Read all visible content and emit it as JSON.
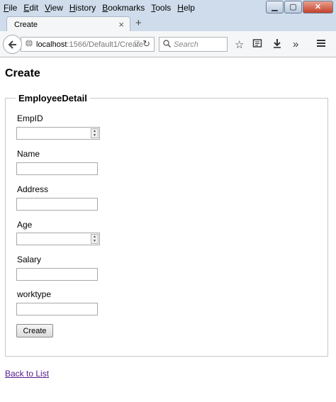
{
  "menu": {
    "items": [
      {
        "key": "F",
        "rest": "ile"
      },
      {
        "key": "E",
        "rest": "dit"
      },
      {
        "key": "V",
        "rest": "iew"
      },
      {
        "key": "H",
        "rest": "istory"
      },
      {
        "key": "B",
        "rest": "ookmarks"
      },
      {
        "key": "T",
        "rest": "ools"
      },
      {
        "key": "H",
        "rest": "elp"
      }
    ]
  },
  "window_controls": {
    "minimize": "▁",
    "maximize": "▢",
    "close": "✕"
  },
  "tab": {
    "title": "Create",
    "close": "×",
    "new_tab": "+"
  },
  "navbar": {
    "url_host": "localhost",
    "url_path": ":1566/Default1/Create",
    "search_placeholder": "Search",
    "icons": [
      "back-arrow-icon",
      "globe-icon",
      "reload-icon",
      "search-icon",
      "bookmark-star-icon",
      "reading-list-icon",
      "download-icon",
      "overflow-chevron-icon",
      "hamburger-menu-icon"
    ]
  },
  "page": {
    "title": "Create",
    "legend": "EmployeeDetail",
    "fields": [
      {
        "label": "EmpID",
        "value": "",
        "type": "number"
      },
      {
        "label": "Name",
        "value": "",
        "type": "text"
      },
      {
        "label": "Address",
        "value": "",
        "type": "text"
      },
      {
        "label": "Age",
        "value": "",
        "type": "number"
      },
      {
        "label": "Salary",
        "value": "",
        "type": "text"
      },
      {
        "label": "worktype",
        "value": "",
        "type": "text"
      }
    ],
    "submit_label": "Create",
    "back_link": "Back to List"
  },
  "colors": {
    "chrome": "#cfdceb",
    "toolbar": "#f5f6f7",
    "link_visited": "#551a8b"
  }
}
